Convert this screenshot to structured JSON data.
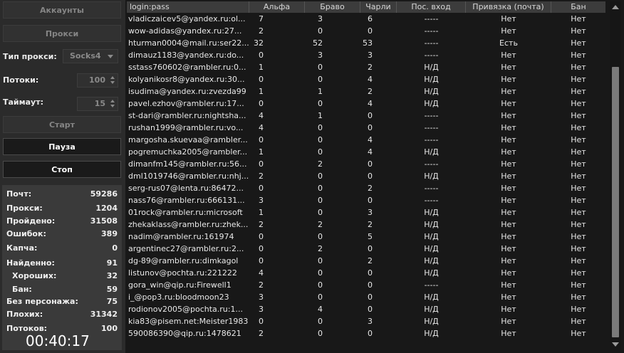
{
  "left": {
    "accounts_button": "Аккаунты",
    "proxy_button": "Прокси",
    "proxy_type_label": "Тип прокси:",
    "proxy_type_value": "Socks4",
    "threads_label": "Потоки:",
    "threads_value": "100",
    "timeout_label": "Таймаут:",
    "timeout_value": "15",
    "start_button": "Старт",
    "pause_button": "Пауза",
    "stop_button": "Стоп",
    "stats": [
      {
        "label": "Почт:",
        "value": "59286"
      },
      {
        "label": "Прокси:",
        "value": "1204"
      },
      {
        "label": "Пройдено:",
        "value": "31508"
      },
      {
        "label": "Ошибок:",
        "value": "389"
      },
      {
        "label": "Капча:",
        "value": "0"
      },
      {
        "label": "Найденно:",
        "value": "91"
      },
      {
        "label": "Хороших:",
        "value": "32"
      },
      {
        "label": "Бан:",
        "value": "59"
      },
      {
        "label": "Без персонажа:",
        "value": "75"
      },
      {
        "label": "Плохих:",
        "value": "31342"
      },
      {
        "label": "Потоков:",
        "value": "100"
      }
    ],
    "timer": "00:40:17"
  },
  "table": {
    "columns": [
      "login:pass",
      "Альфа",
      "Браво",
      "Чарли",
      "Пос. вход",
      "Привязка (почта)",
      "Бан"
    ],
    "rows": [
      [
        "vladiczaicev5@yandex.ru:ol...",
        "7",
        "3",
        "6",
        "-----",
        "Нет",
        "Нет"
      ],
      [
        "wow-adidas@yandex.ru:27...",
        "2",
        "0",
        "0",
        "-----",
        "Нет",
        "Нет"
      ],
      [
        "hturman0004@mail.ru:ser22...",
        "32",
        "52",
        "53",
        "-----",
        "Есть",
        "Нет"
      ],
      [
        "dimauz1183@yandex.ru:do...",
        "0",
        "3",
        "3",
        "-----",
        "Нет",
        "Нет"
      ],
      [
        "sstass760602@rambler.ru:0...",
        "1",
        "0",
        "2",
        "Н/Д",
        "Нет",
        "Нет"
      ],
      [
        "kolyanikosr8@yandex.ru:30...",
        "0",
        "0",
        "4",
        "Н/Д",
        "Нет",
        "Нет"
      ],
      [
        "isudima@yandex.ru:zvezda99",
        "1",
        "1",
        "2",
        "Н/Д",
        "Нет",
        "Нет"
      ],
      [
        "pavel.ezhov@rambler.ru:17...",
        "0",
        "0",
        "4",
        "Н/Д",
        "Нет",
        "Нет"
      ],
      [
        "st-dari@rambler.ru:nightsha...",
        "4",
        "1",
        "0",
        "-----",
        "Нет",
        "Нет"
      ],
      [
        "rushan1999@rambler.ru:vo...",
        "4",
        "0",
        "0",
        "-----",
        "Нет",
        "Нет"
      ],
      [
        "margosha.skuevaa@rambler...",
        "0",
        "0",
        "4",
        "-----",
        "Нет",
        "Нет"
      ],
      [
        "pogremuchka2005@rambler...",
        "1",
        "0",
        "4",
        "Н/Д",
        "Нет",
        "Нет"
      ],
      [
        "dimanfm145@rambler.ru:56...",
        "0",
        "2",
        "0",
        "-----",
        "Нет",
        "Нет"
      ],
      [
        "dml1019746@rambler.ru:nhj...",
        "2",
        "0",
        "0",
        "Н/Д",
        "Нет",
        "Нет"
      ],
      [
        "serg-rus07@lenta.ru:86472...",
        "0",
        "0",
        "2",
        "-----",
        "Нет",
        "Нет"
      ],
      [
        "nass76@rambler.ru:666131...",
        "3",
        "0",
        "0",
        "-----",
        "Нет",
        "Нет"
      ],
      [
        "01rock@rambler.ru:microsoft",
        "1",
        "0",
        "3",
        "Н/Д",
        "Нет",
        "Нет"
      ],
      [
        "zhekaklass@rambler.ru:zhek...",
        "2",
        "2",
        "2",
        "Н/Д",
        "Нет",
        "Нет"
      ],
      [
        "nadim@rambler.ru:161974",
        "0",
        "0",
        "5",
        "Н/Д",
        "Нет",
        "Нет"
      ],
      [
        "argentinec27@rambler.ru:2...",
        "0",
        "2",
        "0",
        "Н/Д",
        "Нет",
        "Нет"
      ],
      [
        "dg-89@rambler.ru:dimkagol",
        "0",
        "0",
        "2",
        "Н/Д",
        "Нет",
        "Нет"
      ],
      [
        "listunov@pochta.ru:221222",
        "4",
        "0",
        "0",
        "Н/Д",
        "Нет",
        "Нет"
      ],
      [
        "gora_win@qip.ru:Firewell1",
        "2",
        "0",
        "0",
        "-----",
        "Нет",
        "Нет"
      ],
      [
        "i_@pop3.ru:bloodmoon23",
        "3",
        "0",
        "0",
        "Н/Д",
        "Нет",
        "Нет"
      ],
      [
        "rodionov2005@pochta.ru:1...",
        "3",
        "4",
        "0",
        "Н/Д",
        "Нет",
        "Нет"
      ],
      [
        "kia83@pisem.net:Meister1983",
        "0",
        "0",
        "3",
        "Н/Д",
        "Нет",
        "Нет"
      ],
      [
        "590086390@qip.ru:1478621",
        "2",
        "0",
        "0",
        "Н/Д",
        "Нет",
        "Нет"
      ]
    ]
  }
}
